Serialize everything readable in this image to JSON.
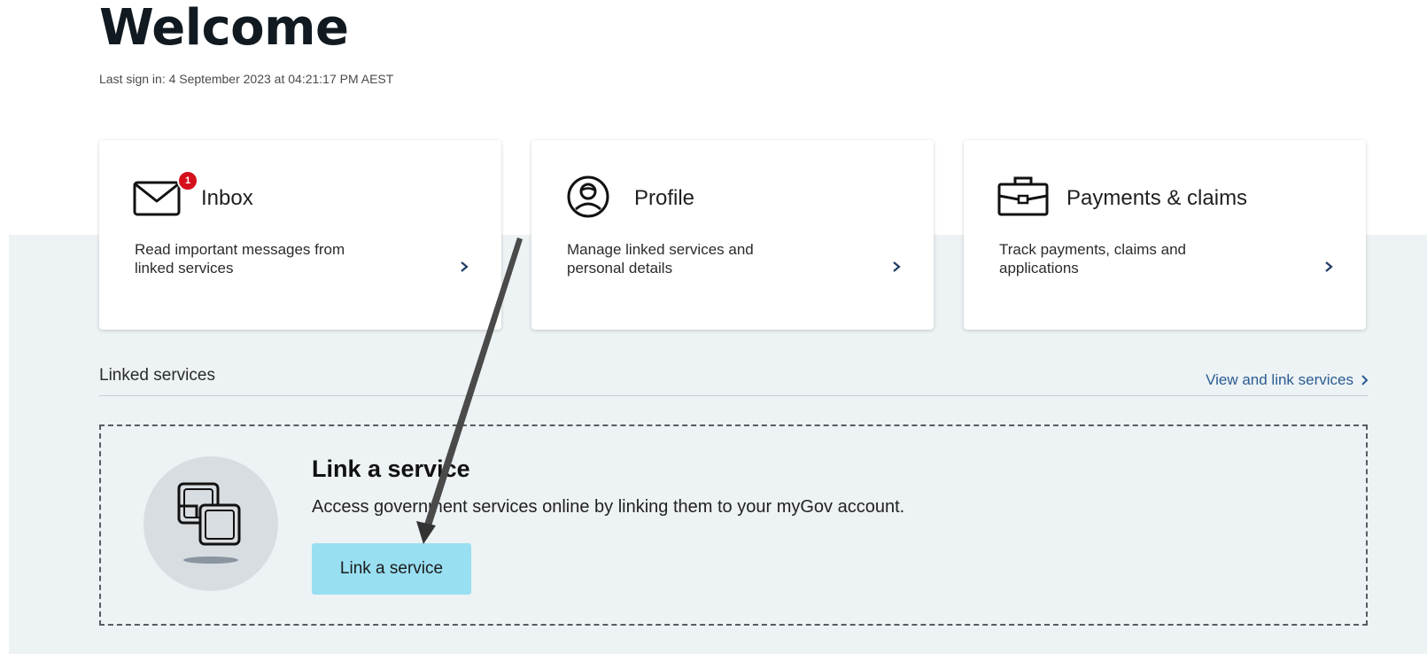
{
  "page": {
    "title": "Welcome",
    "last_sign_in": "Last sign in: 4 September 2023 at 04:21:17 PM AEST"
  },
  "cards": [
    {
      "title": "Inbox",
      "description": "Read important messages from linked services",
      "icon": "envelope-icon",
      "badge": "1"
    },
    {
      "title": "Profile",
      "description": "Manage linked services and personal details",
      "icon": "profile-icon"
    },
    {
      "title": "Payments & claims",
      "description": "Track payments, claims and applications",
      "icon": "briefcase-icon"
    }
  ],
  "linked_services": {
    "heading": "Linked services",
    "view_link": "View and link services"
  },
  "link_service": {
    "title": "Link a service",
    "description": "Access government services online by linking them to your myGov account.",
    "button_label": "Link a service",
    "icon": "link-chain-icon"
  },
  "colors": {
    "grey_band": "#edf2f4",
    "badge_red": "#d4101d",
    "link_blue": "#2b5c92",
    "button_cyan": "#99dff2"
  }
}
